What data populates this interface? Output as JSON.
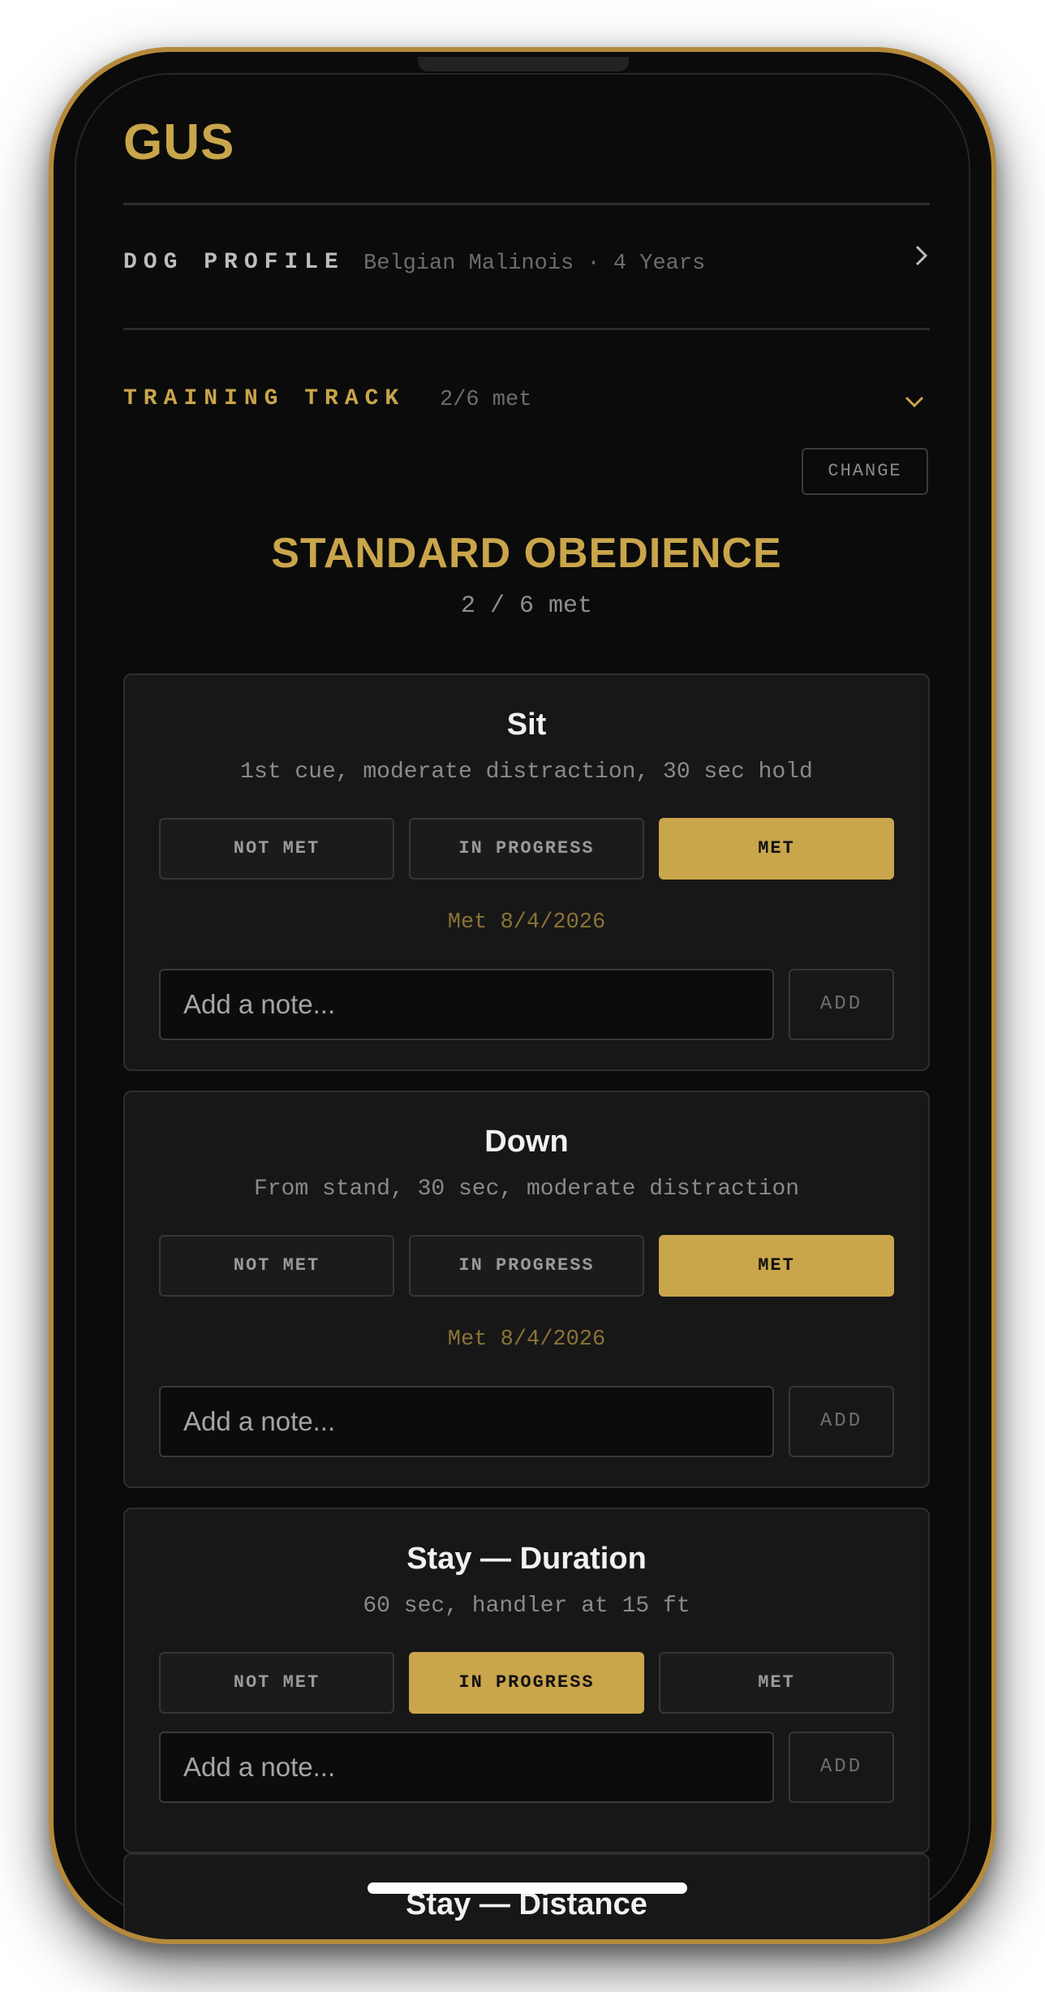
{
  "dog": {
    "name": "GUS"
  },
  "profile": {
    "label": "DOG PROFILE",
    "summary": "Belgian Malinois · 4 Years",
    "chevron_icon": "chevron-right-icon"
  },
  "training_track": {
    "label": "TRAINING TRACK",
    "progress_text": "2/6 met",
    "chevron_icon": "chevron-down-icon"
  },
  "change_button": "CHANGE",
  "track": {
    "title": "STANDARD OBEDIENCE",
    "count": "2 / 6 met"
  },
  "status_options": [
    "NOT MET",
    "IN PROGRESS",
    "MET"
  ],
  "note_placeholder": "Add a note...",
  "add_label": "ADD",
  "skills": [
    {
      "name": "Sit",
      "description": "1st cue, moderate distraction, 30 sec hold",
      "status": "MET",
      "met_date": "Met 8/4/2026"
    },
    {
      "name": "Down",
      "description": "From stand, 30 sec, moderate distraction",
      "status": "MET",
      "met_date": "Met 8/4/2026"
    },
    {
      "name": "Stay — Duration",
      "description": "60 sec, handler at 15 ft",
      "status": "IN PROGRESS",
      "met_date": ""
    },
    {
      "name": "Stay — Distance"
    }
  ],
  "colors": {
    "accent": "#c9a54b",
    "frame": "#b58a3c",
    "background": "#0b0b0b",
    "card": "#171717"
  }
}
